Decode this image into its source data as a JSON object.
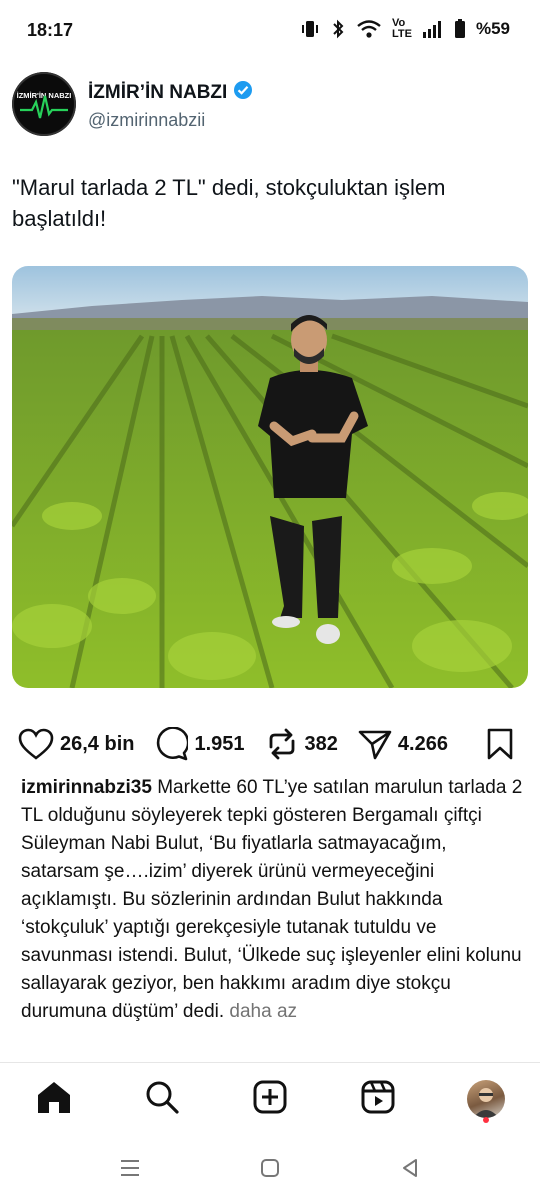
{
  "status_bar": {
    "time": "18:17",
    "network_label": "Vo\nLTE",
    "battery": "%59",
    "icons": [
      "vibrate-icon",
      "bluetooth-icon",
      "wifi-icon",
      "volte-icon",
      "signal-icon",
      "battery-icon"
    ]
  },
  "account": {
    "name": "İZMİR’İN NABZI",
    "handle": "@izmirinnabzii",
    "logo_text": "İZMİR'İN NABZI",
    "verified_color": "#1d9bf0"
  },
  "tweet": {
    "text": "\"Marul tarlada 2 TL\" dedi, stokçuluktan işlem başlatıldı!"
  },
  "actions": {
    "likes": "26,4 bin",
    "comments": "1.951",
    "reposts": "382",
    "shares": "4.266"
  },
  "caption": {
    "username": "izmirinnabzi35",
    "body": "Markette 60 TL’ye satılan marulun tarlada 2 TL olduğunu söyleyerek tepki gösteren Bergamalı çiftçi Süleyman Nabi Bulut, ‘Bu fiyatlarla satmayacağım, satarsam şe….izim’ diyerek ürünü vermeyeceğini açıklamıştı. Bu sözlerinin ardından Bulut hakkında ‘stokçuluk’ yaptığı gerekçesiyle tutanak tutuldu ve savunması istendi. Bulut, ‘Ülkede suç işleyenler elini kolunu sallayarak geziyor, ben hakkımı aradım diye stokçu durumuna düştüm’ dedi.",
    "more_label": "daha az"
  },
  "bottom_nav": {
    "items": [
      "home-icon",
      "search-icon",
      "create-icon",
      "reels-icon",
      "profile-avatar"
    ]
  },
  "system_nav": {
    "items": [
      "recents-icon",
      "home-circle-icon",
      "back-icon"
    ]
  },
  "colors": {
    "text": "#0f1419",
    "muted": "#536471",
    "accent": "#1d9bf0",
    "notification": "#ff3040"
  }
}
